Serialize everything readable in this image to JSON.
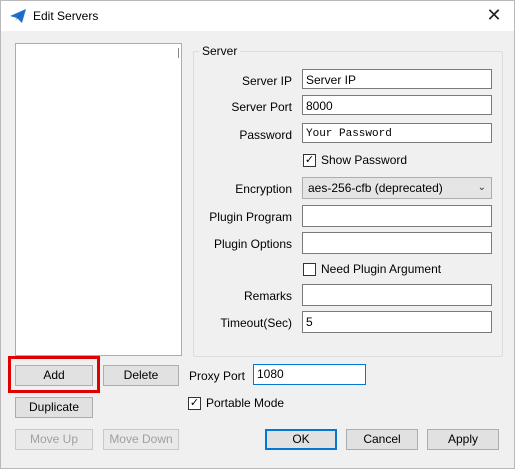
{
  "window": {
    "title": "Edit Servers",
    "close_label": "✕"
  },
  "server_group": {
    "legend": "Server",
    "server_ip": {
      "label": "Server IP",
      "value": "Server IP"
    },
    "server_port": {
      "label": "Server Port",
      "value": "8000"
    },
    "password": {
      "label": "Password",
      "value": "Your Password"
    },
    "show_password": {
      "label": "Show Password",
      "checked": true,
      "mark": "✓"
    },
    "encryption": {
      "label": "Encryption",
      "value": "aes-256-cfb (deprecated)",
      "chevron": "⌄"
    },
    "plugin_program": {
      "label": "Plugin Program",
      "value": ""
    },
    "plugin_options": {
      "label": "Plugin Options",
      "value": ""
    },
    "need_plugin_argument": {
      "label": "Need Plugin Argument",
      "checked": false
    },
    "remarks": {
      "label": "Remarks",
      "value": ""
    },
    "timeout": {
      "label": "Timeout(Sec)",
      "value": "5"
    }
  },
  "buttons": {
    "add": "Add",
    "delete": "Delete",
    "duplicate": "Duplicate",
    "move_up": "Move Up",
    "move_down": "Move Down",
    "ok": "OK",
    "cancel": "Cancel",
    "apply": "Apply"
  },
  "proxy": {
    "label": "Proxy Port",
    "value": "1080"
  },
  "portable_mode": {
    "label": "Portable Mode",
    "checked": true,
    "mark": "✓"
  },
  "colors": {
    "highlight": "#e00000",
    "focus": "#0078d7",
    "app_icon": "#1e6fd0"
  }
}
